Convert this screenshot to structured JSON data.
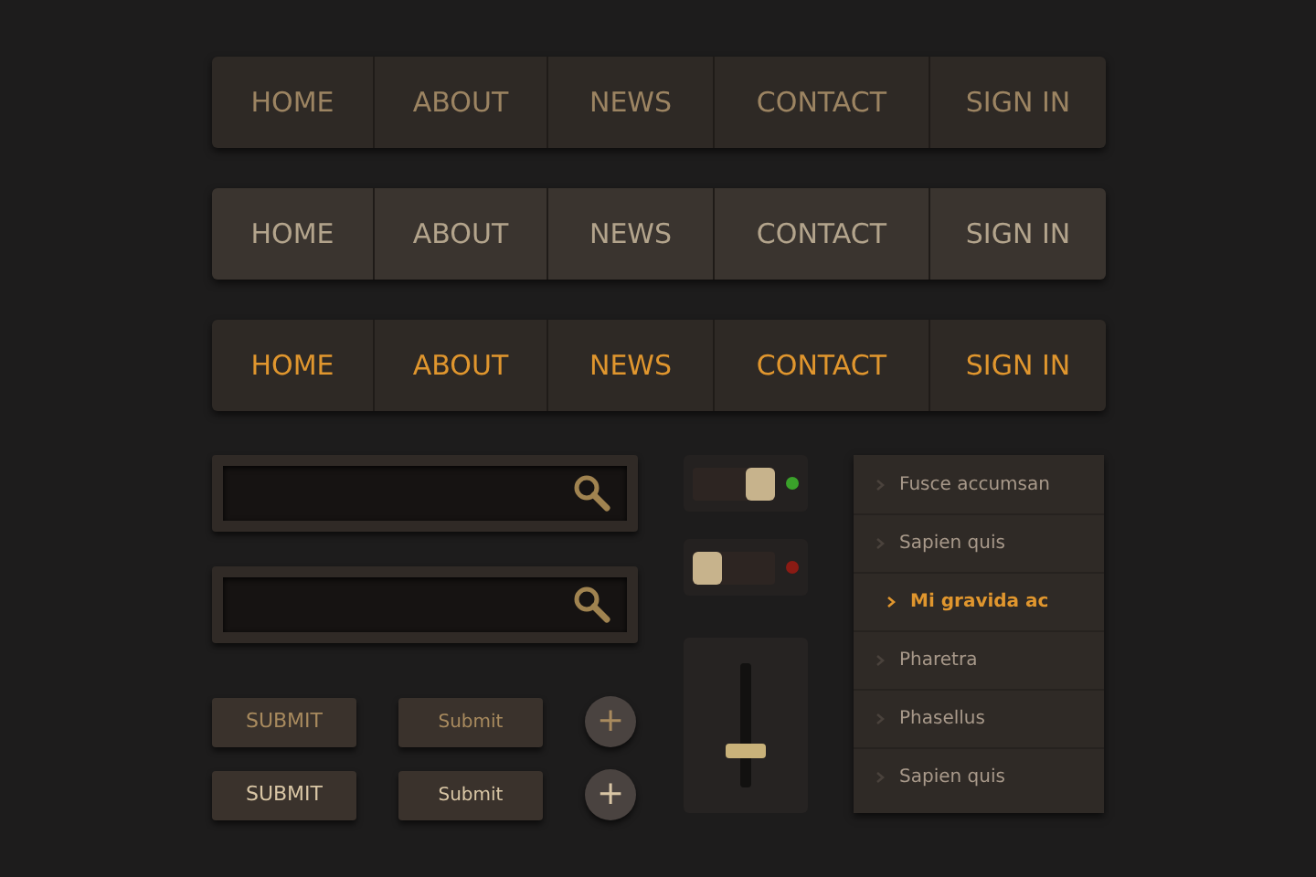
{
  "nav_bars": [
    {
      "kind": "normal",
      "items": [
        "HOME",
        "ABOUT",
        "NEWS",
        "CONTACT",
        "SIGN IN"
      ]
    },
    {
      "kind": "hover",
      "items": [
        "HOME",
        "ABOUT",
        "NEWS",
        "CONTACT",
        "SIGN IN"
      ]
    },
    {
      "kind": "active",
      "items": [
        "HOME",
        "ABOUT",
        "NEWS",
        "CONTACT",
        "SIGN IN"
      ]
    }
  ],
  "search_fields": [
    {
      "kind": "search"
    },
    {
      "kind": "search"
    }
  ],
  "button_rows": [
    {
      "highlighted": false,
      "buttons": [
        {
          "kind": "caps",
          "label": "SUBMIT"
        },
        {
          "kind": "small",
          "label": "Submit"
        },
        {
          "kind": "round",
          "label": "+"
        }
      ]
    },
    {
      "highlighted": true,
      "buttons": [
        {
          "kind": "caps",
          "label": "SUBMIT"
        },
        {
          "kind": "small",
          "label": "Submit"
        },
        {
          "kind": "round",
          "label": "+"
        }
      ]
    }
  ],
  "toggles": [
    {
      "on": true
    },
    {
      "on": false
    }
  ],
  "slider": {
    "level": 0.27
  },
  "menu": [
    {
      "label": "Fusce accumsan",
      "selected": false
    },
    {
      "label": "Sapien quis",
      "selected": false
    },
    {
      "label": "Mi gravida ac",
      "selected": true
    },
    {
      "label": "Pharetra",
      "selected": false
    },
    {
      "label": "Phasellus",
      "selected": false
    },
    {
      "label": "Sapien quis",
      "selected": false
    }
  ]
}
